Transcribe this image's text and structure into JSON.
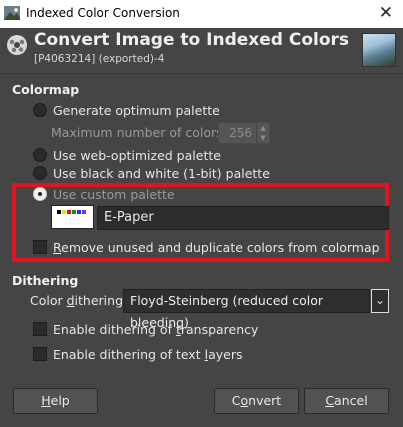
{
  "window": {
    "title": "Indexed Color Conversion",
    "close_glyph": "✕"
  },
  "header": {
    "title": "Convert Image to Indexed Colors",
    "subtitle": "[P4063214] (exported)-4"
  },
  "colormap": {
    "section_title": "Colormap",
    "options": [
      {
        "label": "Generate optimum palette",
        "selected": false,
        "enabled": true
      },
      {
        "label": "Use web-optimized palette",
        "selected": false,
        "enabled": true
      },
      {
        "label": "Use black and white (1-bit) palette",
        "selected": false,
        "enabled": true
      },
      {
        "label": "Use custom palette",
        "selected": true,
        "enabled": false
      }
    ],
    "max_colors_label": "Maximum number of colors:",
    "max_colors_value": "256",
    "custom_palette_name": "E-Paper",
    "remove_unused_label_prefix": "R",
    "remove_unused_label_rest": "emove unused and duplicate colors from colormap",
    "remove_unused_checked": false
  },
  "dithering": {
    "section_title": "Dithering",
    "color_dithering_label_a": "Color ",
    "color_dithering_label_u": "d",
    "color_dithering_label_b": "ithering:",
    "color_dithering_value": "Floyd-Steinberg (reduced color bleeding)",
    "transparency_label_a": "Enable dithering of ",
    "transparency_label_u": "t",
    "transparency_label_b": "ransparency",
    "text_layers_label_a": "Enable dithering of text ",
    "text_layers_label_u": "l",
    "text_layers_label_b": "ayers"
  },
  "buttons": {
    "help_u": "H",
    "help_rest": "elp",
    "convert_a": "C",
    "convert_u": "o",
    "convert_b": "nvert",
    "cancel_u": "C",
    "cancel_rest": "ancel"
  },
  "colors": {
    "background": "#454545",
    "highlight_box": "#e0141e",
    "text": "#e6e6e6"
  }
}
